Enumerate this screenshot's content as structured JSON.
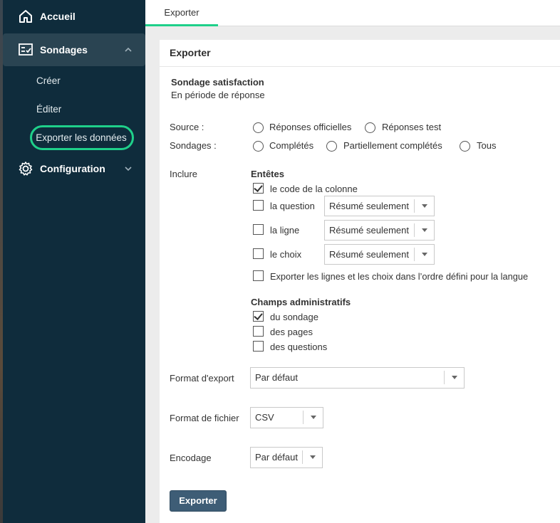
{
  "sidebar": {
    "accueil": "Accueil",
    "sondages": "Sondages",
    "sub_items": [
      "Créer",
      "Éditer",
      "Exporter les données"
    ],
    "configuration": "Configuration",
    "icons": [
      "home-icon",
      "survey-icon",
      "gear-icon",
      "chevron-up-icon",
      "chevron-down-icon"
    ],
    "highlight_color": "#1fd08a"
  },
  "tabs": {
    "active": "Exporter"
  },
  "panel": {
    "title": "Exporter",
    "survey_name": "Sondage satisfaction",
    "survey_status": "En période de réponse"
  },
  "source": {
    "label": "Source :",
    "options": [
      "Réponses officielles",
      "Réponses test"
    ],
    "selected": null
  },
  "sondages_filter": {
    "label": "Sondages :",
    "options": [
      "Complétés",
      "Partiellement complétés",
      "Tous"
    ],
    "selected": null
  },
  "inclure": {
    "label": "Inclure",
    "headers_title": "Entêtes",
    "headers": [
      {
        "label": "le code de la colonne",
        "checked": true
      },
      {
        "label": "la question",
        "checked": false,
        "select": "Résumé seulement"
      },
      {
        "label": "la ligne",
        "checked": false,
        "select": "Résumé seulement"
      },
      {
        "label": "le choix",
        "checked": false,
        "select": "Résumé seulement"
      },
      {
        "label": "Exporter les lignes et les choix dans l’ordre défini pour la langue",
        "checked": false
      }
    ],
    "admin_title": "Champs administratifs",
    "admin": [
      {
        "label": "du sondage",
        "checked": true
      },
      {
        "label": "des pages",
        "checked": false
      },
      {
        "label": "des questions",
        "checked": false
      }
    ]
  },
  "format_export": {
    "label": "Format d'export",
    "value": "Par défaut"
  },
  "format_fichier": {
    "label": "Format de fichier",
    "value": "CSV"
  },
  "encodage": {
    "label": "Encodage",
    "value": "Par défaut"
  },
  "submit": "Exporter"
}
